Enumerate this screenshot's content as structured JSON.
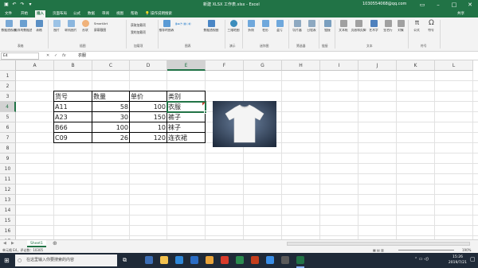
{
  "titlebar": {
    "doc_title": "新建 XLSX 工作表.xlsx - Excel",
    "user_email": "1030554068@qq.com",
    "accent": "#217346"
  },
  "ribbon_tabs": [
    "文件",
    "开始",
    "插入",
    "页面布局",
    "公式",
    "数据",
    "审阅",
    "视图",
    "帮助",
    "操作说明搜索"
  ],
  "active_tab": "插入",
  "share_label": "共享",
  "ribbon": {
    "buttons": [
      {
        "label": "数据透视表",
        "icon": "pivot-table-icon"
      },
      {
        "label": "推荐的数据透视表",
        "icon": "recommended-pivot-icon"
      },
      {
        "label": "表格",
        "icon": "table-icon"
      },
      {
        "label": "图片",
        "icon": "picture-icon"
      },
      {
        "label": "联机图片",
        "icon": "online-picture-icon"
      },
      {
        "label": "形状",
        "icon": "shapes-icon"
      },
      {
        "label": "推荐的图表",
        "icon": "recommended-charts-icon"
      },
      {
        "label": "数据透视图",
        "icon": "pivot-chart-icon"
      },
      {
        "label": "三维地图",
        "icon": "3d-map-icon"
      },
      {
        "label": "折线",
        "icon": "line-sparkline-icon"
      },
      {
        "label": "柱形",
        "icon": "column-sparkline-icon"
      },
      {
        "label": "盈亏",
        "icon": "win-loss-icon"
      },
      {
        "label": "切片器",
        "icon": "slicer-icon"
      },
      {
        "label": "日程表",
        "icon": "timeline-icon"
      },
      {
        "label": "链接",
        "icon": "link-icon"
      },
      {
        "label": "文本框",
        "icon": "textbox-icon"
      },
      {
        "label": "页眉和页脚",
        "icon": "header-footer-icon"
      },
      {
        "label": "艺术字",
        "icon": "wordart-icon"
      },
      {
        "label": "签名行",
        "icon": "signature-icon"
      },
      {
        "label": "对象",
        "icon": "object-icon"
      },
      {
        "label": "公式",
        "icon": "equation-icon"
      },
      {
        "label": "符号",
        "icon": "symbol-icon"
      }
    ],
    "small_items": [
      "SmartArt",
      "屏幕截图",
      "获取加载项",
      "我的加载项"
    ],
    "groups": [
      "表格",
      "插图",
      "加载项",
      "图表",
      "演示",
      "迷你图",
      "筛选器",
      "链接",
      "文本",
      "符号"
    ]
  },
  "formula_bar": {
    "name_box": "E4",
    "formula": "衣服"
  },
  "columns": [
    "A",
    "B",
    "C",
    "D",
    "E",
    "F",
    "G",
    "H",
    "I",
    "J",
    "K",
    "L"
  ],
  "rows": [
    "1",
    "2",
    "3",
    "4",
    "5",
    "6",
    "7",
    "8",
    "9",
    "10",
    "11",
    "12",
    "13",
    "14",
    "15",
    "16",
    "17"
  ],
  "table": {
    "headers": [
      "货号",
      "数量",
      "单价",
      "类别"
    ],
    "rows": [
      [
        "A11",
        "58",
        "100",
        "衣服"
      ],
      [
        "A23",
        "30",
        "150",
        "裤子"
      ],
      [
        "B66",
        "100",
        "10",
        "袜子"
      ],
      [
        "C09",
        "26",
        "120",
        "连衣裙"
      ]
    ]
  },
  "picture": {
    "icon": "tshirt-image"
  },
  "sheet_tab": "Sheet1",
  "status_bar": {
    "left": "单元格 E4，评论数：10305",
    "zoom": "190%"
  },
  "taskbar": {
    "search_placeholder": "在这里输入你要搜索的内容",
    "time": "15:26",
    "date": "2019/7/21"
  }
}
